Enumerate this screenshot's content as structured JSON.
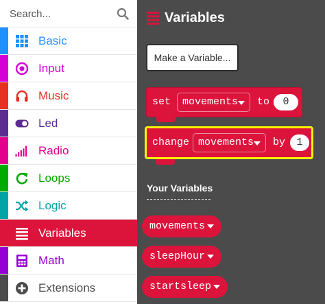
{
  "search": {
    "placeholder": "Search...",
    "icon": "search-icon"
  },
  "categories": [
    {
      "label": "Basic",
      "icon": "grid-icon",
      "color": "#1e90ff"
    },
    {
      "label": "Input",
      "icon": "target-icon",
      "color": "#d400d4"
    },
    {
      "label": "Music",
      "icon": "headphones-icon",
      "color": "#e63022"
    },
    {
      "label": "Led",
      "icon": "toggle-icon",
      "color": "#5c2d91"
    },
    {
      "label": "Radio",
      "icon": "signal-bars-icon",
      "color": "#e3008c"
    },
    {
      "label": "Loops",
      "icon": "refresh-icon",
      "color": "#00aa00"
    },
    {
      "label": "Logic",
      "icon": "shuffle-icon",
      "color": "#00a4a6"
    },
    {
      "label": "Variables",
      "icon": "list-icon",
      "color": "#dc143c",
      "selected": true
    },
    {
      "label": "Math",
      "icon": "calculator-icon",
      "color": "#9400d3"
    },
    {
      "label": "Extensions",
      "icon": "plus-circle-icon",
      "color": "#4b4b4b"
    }
  ],
  "flyout": {
    "title": "Variables",
    "title_icon": "list-icon",
    "background": "#4b4b4b",
    "make_variable_label": "Make a Variable...",
    "set_block": {
      "keyword": "set",
      "variable": "movements",
      "to_word": "to",
      "value": "0"
    },
    "change_block": {
      "keyword": "change",
      "variable": "movements",
      "by_word": "by",
      "value": "1"
    },
    "section_label": "Your Variables",
    "variables": [
      "movements",
      "sleepHour",
      "startsleep"
    ]
  },
  "colors": {
    "variables_accent": "#dc143c",
    "highlight": "#fff200"
  }
}
